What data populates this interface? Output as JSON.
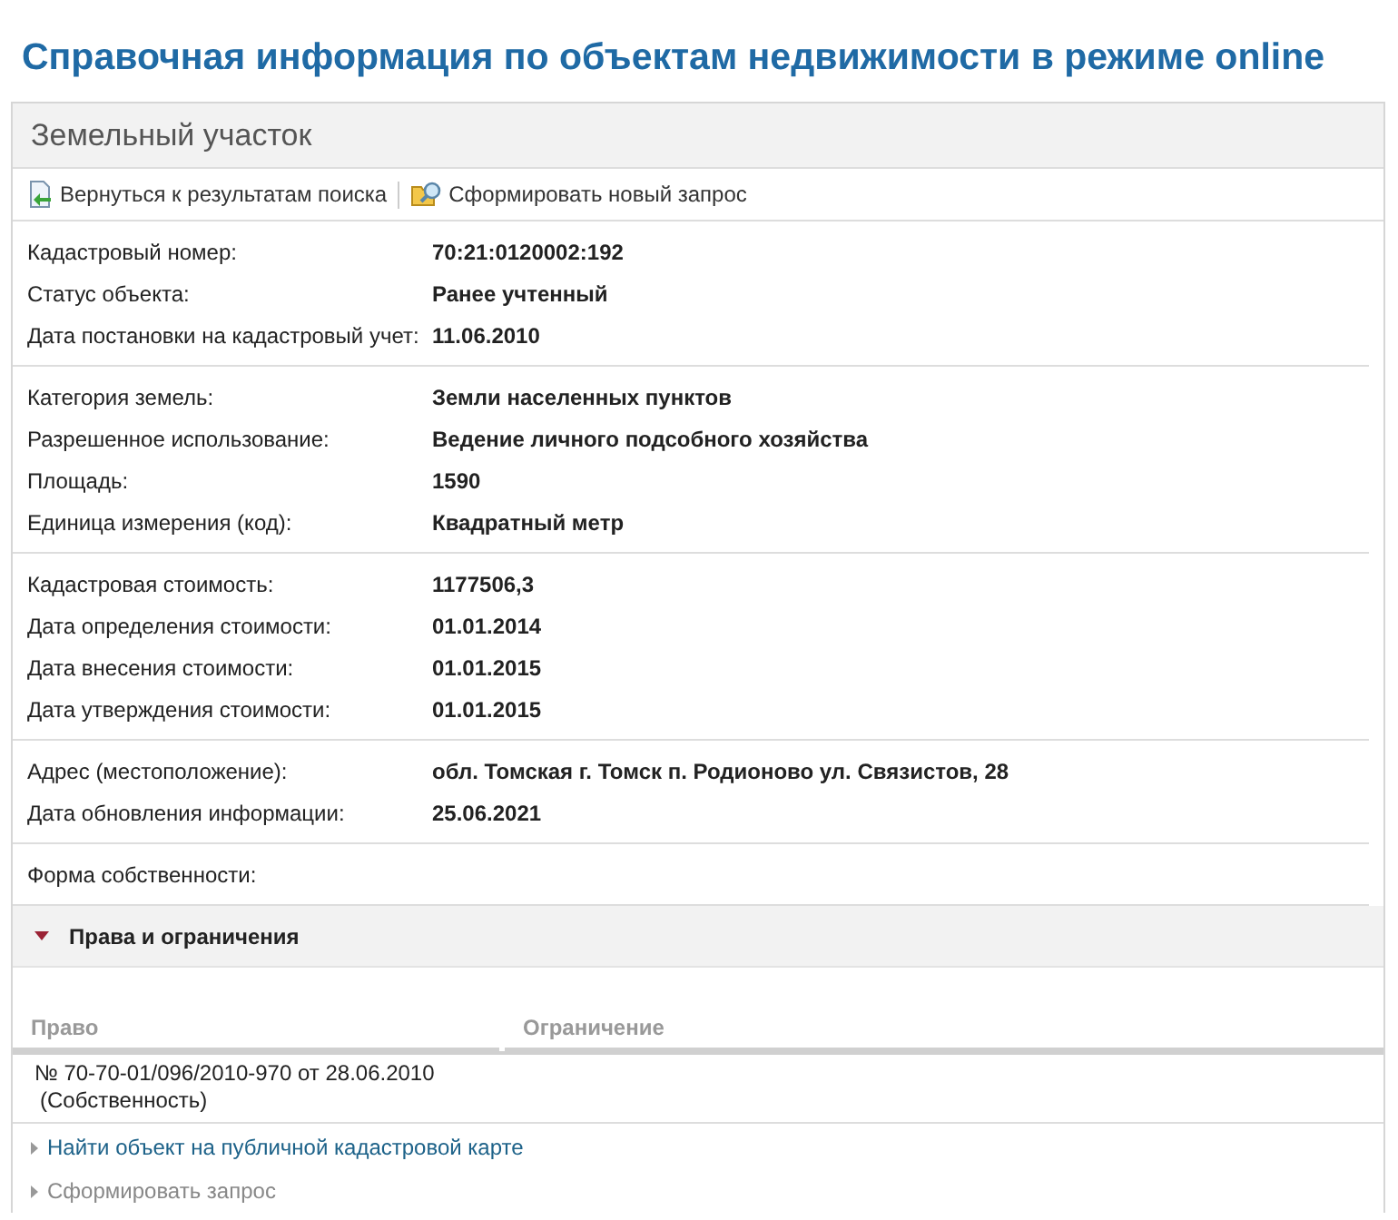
{
  "page_title": "Справочная информация по объектам недвижимости в режиме online",
  "panel": {
    "title": "Земельный участок",
    "toolbar": [
      {
        "kind": "back",
        "label": "Вернуться к результатам поиска"
      },
      {
        "kind": "query",
        "label": "Сформировать новый запрос"
      }
    ],
    "groups": [
      [
        {
          "label": "Кадастровый номер:",
          "value": "70:21:0120002:192"
        },
        {
          "label": "Статус объекта:",
          "value": "Ранее учтенный"
        },
        {
          "label": "Дата постановки на кадастровый учет:",
          "value": "11.06.2010"
        }
      ],
      [
        {
          "label": "Категория земель:",
          "value": "Земли населенных пунктов"
        },
        {
          "label": "Разрешенное использование:",
          "value": "Ведение личного подсобного хозяйства"
        },
        {
          "label": "Площадь:",
          "value": "1590"
        },
        {
          "label": "Единица измерения (код):",
          "value": "Квадратный метр"
        }
      ],
      [
        {
          "label": "Кадастровая стоимость:",
          "value": "1177506,3"
        },
        {
          "label": "Дата определения стоимости:",
          "value": "01.01.2014"
        },
        {
          "label": "Дата внесения стоимости:",
          "value": "01.01.2015"
        },
        {
          "label": "Дата утверждения стоимости:",
          "value": "01.01.2015"
        }
      ],
      [
        {
          "label": "Адрес (местоположение):",
          "value": "обл. Томская г. Томск п. Родионово ул. Связистов, 28"
        },
        {
          "label": "Дата обновления информации:",
          "value": "25.06.2021"
        }
      ],
      [
        {
          "label": "Форма собственности:"
        }
      ]
    ],
    "section": {
      "title": "Права и ограничения",
      "expanded": true,
      "columns": [
        "Право",
        "Ограничение"
      ],
      "rows": [
        {
          "right": [
            "№ 70-70-01/096/2010-970  от 28.06.2010",
            "(Собственность)"
          ]
        }
      ]
    },
    "links": [
      {
        "label": "Найти объект на публичной кадастровой карте",
        "disabled": false
      },
      {
        "label": "Сформировать запрос",
        "disabled": true
      }
    ]
  }
}
